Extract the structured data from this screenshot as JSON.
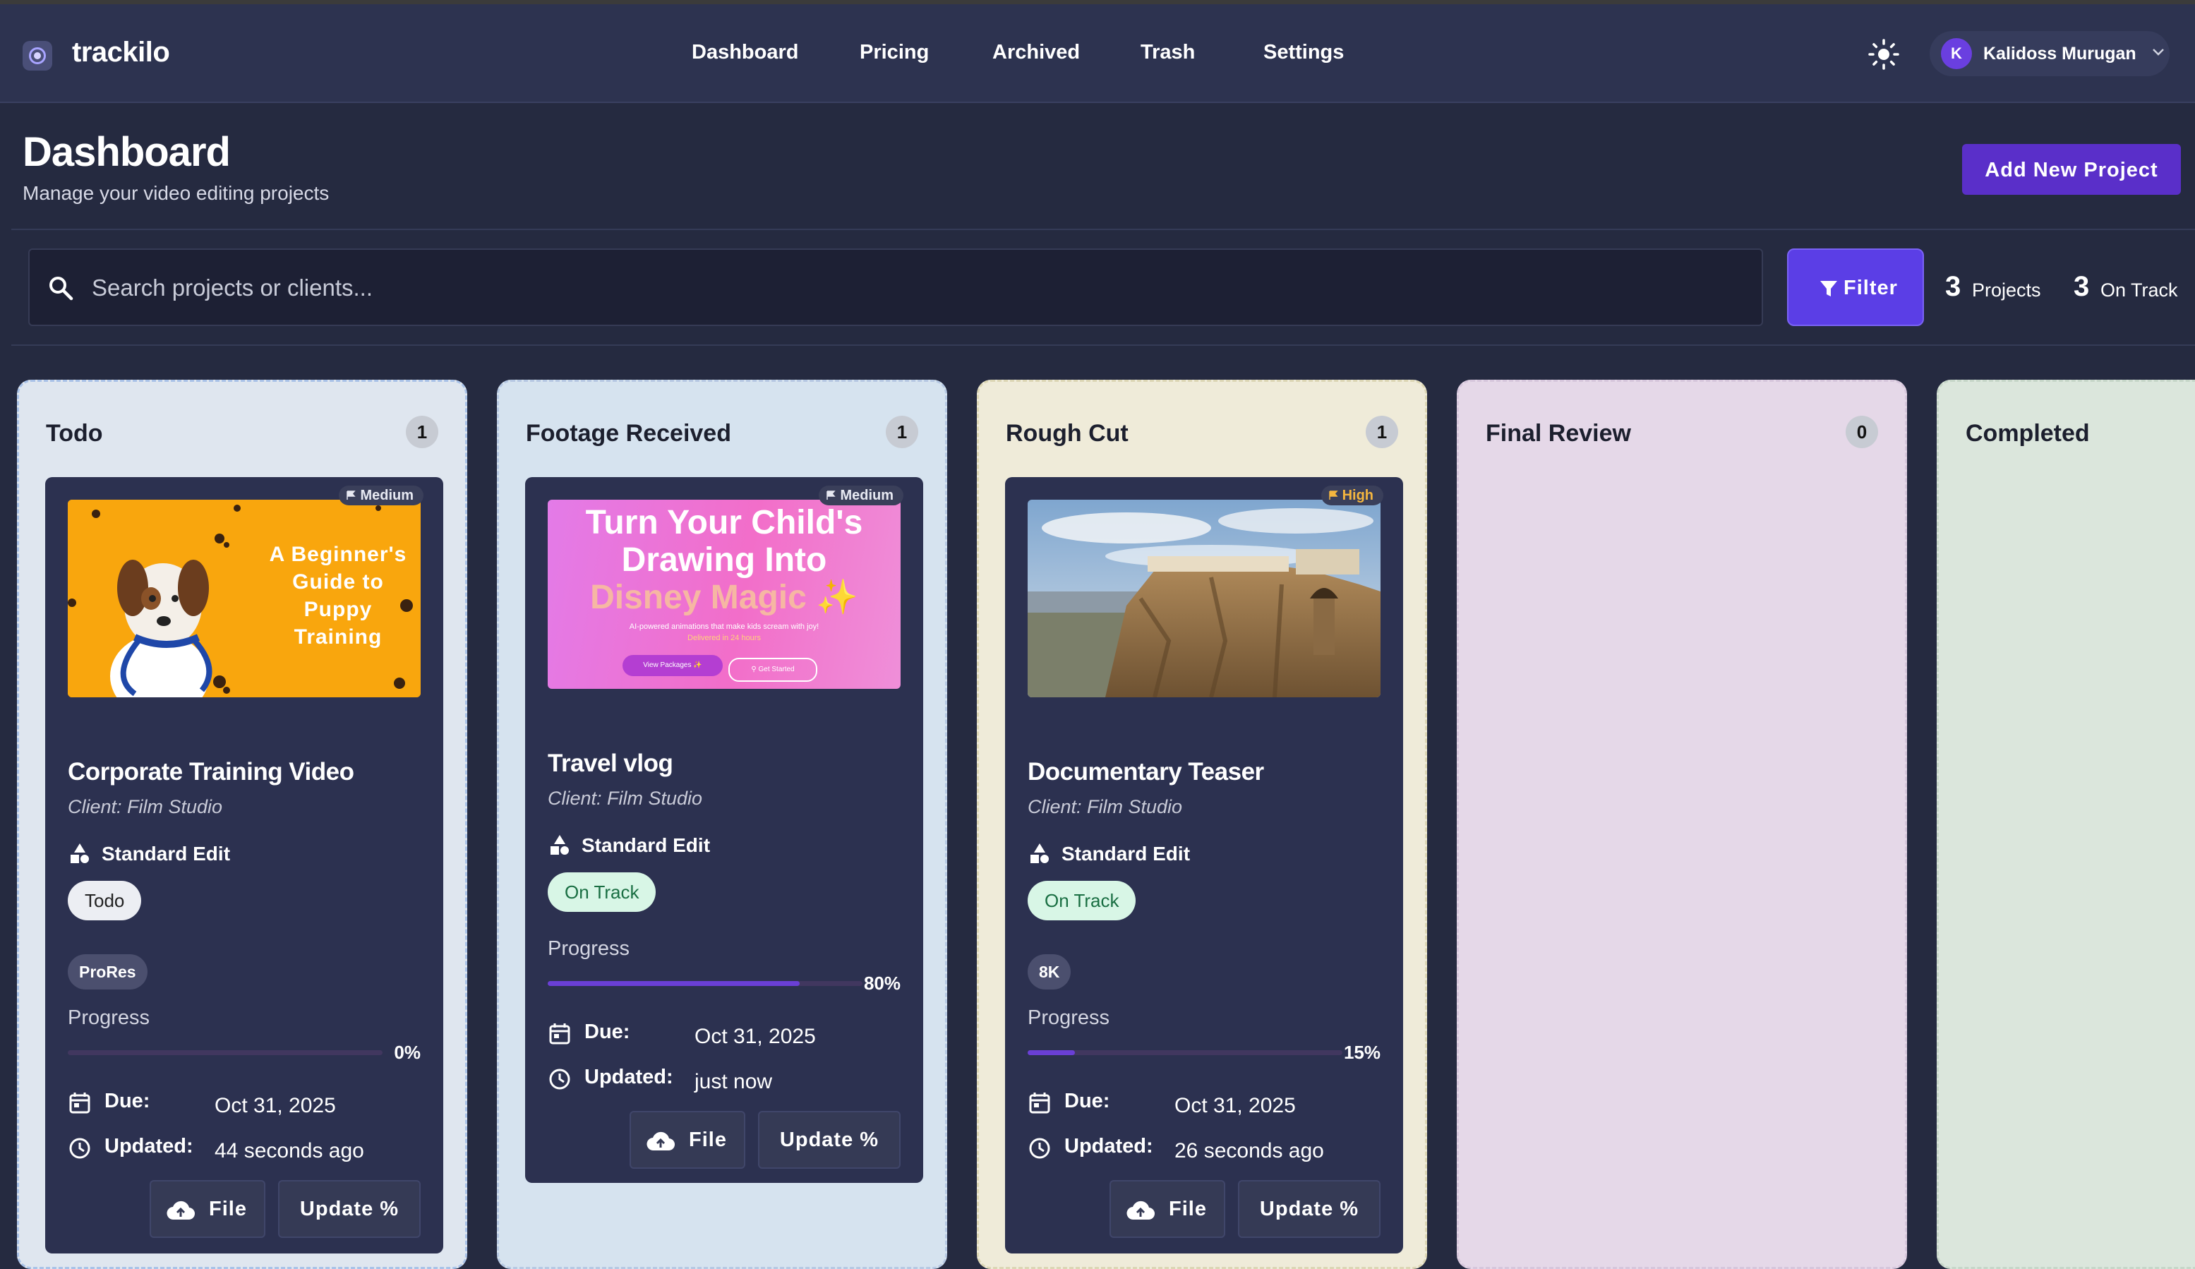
{
  "app": {
    "name": "trackilo"
  },
  "nav": [
    {
      "label": "Dashboard"
    },
    {
      "label": "Pricing"
    },
    {
      "label": "Archived"
    },
    {
      "label": "Trash"
    },
    {
      "label": "Settings"
    }
  ],
  "user": {
    "initial": "K",
    "name": "Kalidoss Murugan"
  },
  "header": {
    "title": "Dashboard",
    "subtitle": "Manage your video editing projects",
    "add_button": "Add New Project"
  },
  "search": {
    "placeholder": "Search projects or clients..."
  },
  "filter": {
    "label": "Filter"
  },
  "stats": {
    "projects_count": "3",
    "projects_label": "Projects",
    "ontrack_count": "3",
    "ontrack_label": "On Track"
  },
  "colors": {
    "accent": "#5a2fc9",
    "col_todo": "#dfe6ef",
    "col_footage": "#d6e3ef",
    "col_rough": "#efebd9",
    "col_final": "#e5d8e8",
    "col_completed": "#dbe6dc",
    "ontrack_bg": "#d8f6e6",
    "ontrack_text": "#1a6f43",
    "todo_chip_bg": "#eceef3"
  },
  "columns": [
    {
      "title": "Todo",
      "count": "1"
    },
    {
      "title": "Footage Received",
      "count": "1"
    },
    {
      "title": "Rough Cut",
      "count": "1"
    },
    {
      "title": "Final Review",
      "count": "0"
    },
    {
      "title": "Completed"
    }
  ],
  "cards": [
    {
      "priority": "Medium",
      "thumb_text": [
        "A Beginner's",
        "Guide to",
        "Puppy",
        "Training"
      ],
      "title": "Corporate Training Video",
      "client": "Client: Film Studio",
      "edit_type": "Standard Edit",
      "status": "Todo",
      "resolution": "ProRes",
      "progress_label": "Progress",
      "progress": 0,
      "progress_text": "0%",
      "due_label": "Due:",
      "due": "Oct 31, 2025",
      "updated_label": "Updated:",
      "updated": "44 seconds ago",
      "file_btn": "File",
      "update_btn": "Update %"
    },
    {
      "priority": "Medium",
      "thumb_text": [
        "Turn Your Child's",
        "Drawing Into",
        "Disney Magic ✨",
        "AI-powered animations that make kids scream with joy!",
        "Delivered in 24 hours",
        "View Packages ✨",
        "⚲ Get Started"
      ],
      "title": "Travel vlog",
      "client": "Client: Film Studio",
      "edit_type": "Standard Edit",
      "status": "On Track",
      "progress_label": "Progress",
      "progress": 80,
      "progress_text": "80%",
      "due_label": "Due:",
      "due": "Oct 31, 2025",
      "updated_label": "Updated:",
      "updated": "just now",
      "file_btn": "File",
      "update_btn": "Update %"
    },
    {
      "priority": "High",
      "title": "Documentary Teaser",
      "client": "Client: Film Studio",
      "edit_type": "Standard Edit",
      "status": "On Track",
      "resolution": "8K",
      "progress_label": "Progress",
      "progress": 15,
      "progress_text": "15%",
      "due_label": "Due:",
      "due": "Oct 31, 2025",
      "updated_label": "Updated:",
      "updated": "26 seconds ago",
      "file_btn": "File",
      "update_btn": "Update %"
    }
  ]
}
